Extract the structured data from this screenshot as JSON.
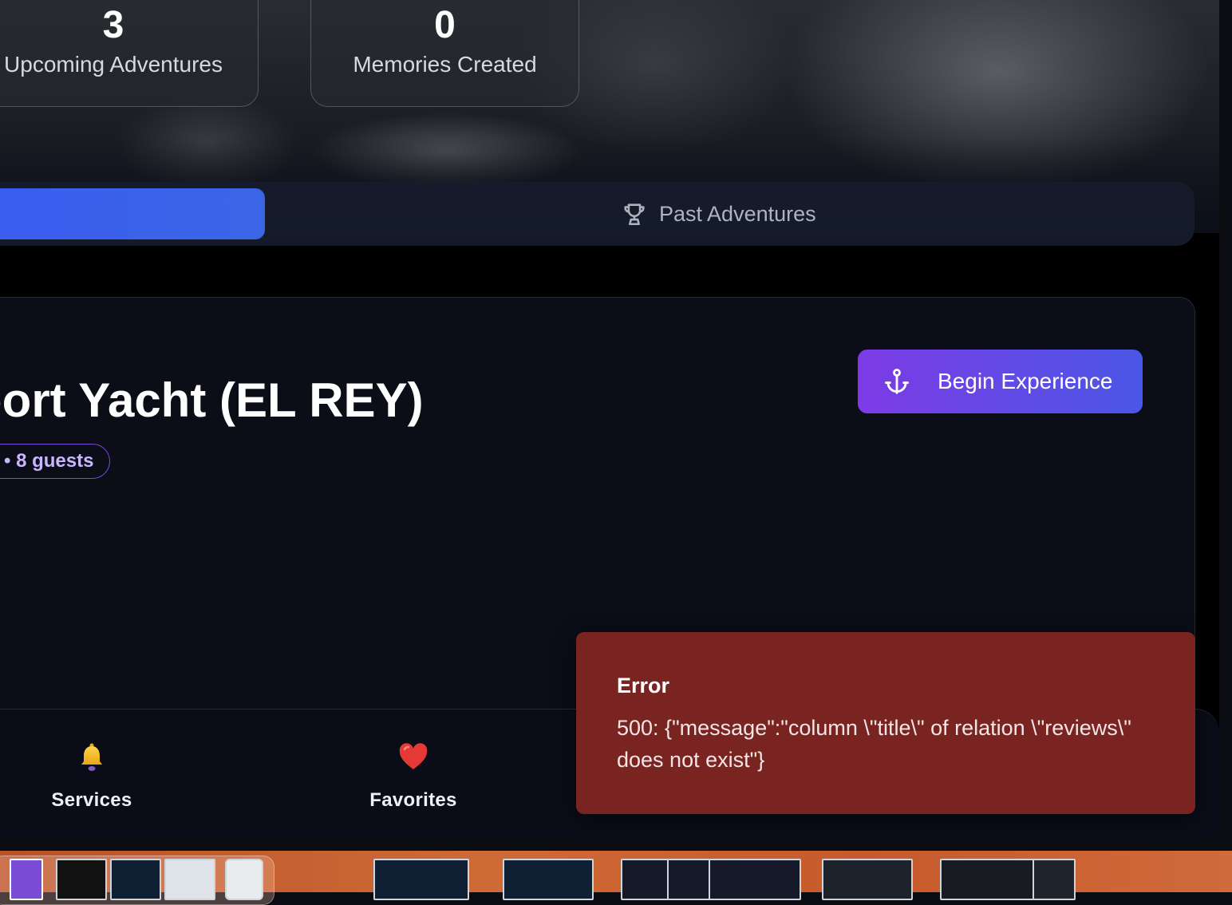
{
  "stats": [
    {
      "value": "3",
      "label": "Upcoming Adventures"
    },
    {
      "value": "0",
      "label": "Memories Created"
    }
  ],
  "tabs": {
    "active_label": "",
    "past_label": "Past Adventures"
  },
  "booking": {
    "title": "Sport Yacht (EL REY)",
    "guests": "• 8 guests",
    "begin_label": "Begin Experience"
  },
  "bottom_nav": {
    "services": "Services",
    "favorites": "Favorites"
  },
  "toast": {
    "title": "Error",
    "message": "500: {\"message\":\"column \\\"title\\\" of relation \\\"reviews\\\" does not exist\"}"
  },
  "icons": {
    "trophy": "trophy-icon",
    "anchor": "anchor-icon",
    "bell": "bell-icon",
    "heart": "heart-icon"
  },
  "colors": {
    "accent_blue": "#3b5df0",
    "accent_purple": "#7d3be6",
    "error_bg": "#7a2422"
  }
}
